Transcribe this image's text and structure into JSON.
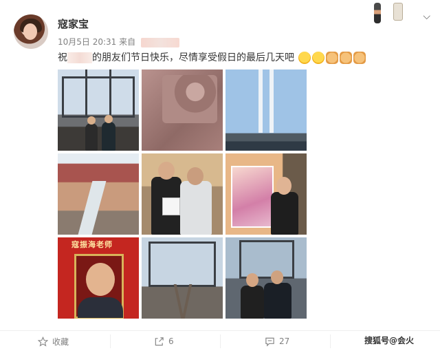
{
  "user": {
    "name": "寇家宝"
  },
  "meta": {
    "time": "10月5日 20:31",
    "source_prefix": "来自"
  },
  "post": {
    "text_before": "祝",
    "text_after": "的朋友们节日快乐，尽情享受假日的最后几天吧"
  },
  "photos": [
    {
      "icon": "bridge-photo"
    },
    {
      "icon": "relief-plaque-photo"
    },
    {
      "icon": "cable-bridge-photo"
    },
    {
      "icon": "red-beach-photo"
    },
    {
      "icon": "couple-photo"
    },
    {
      "icon": "poster-photo"
    },
    {
      "icon": "portrait-banner-photo",
      "banner_text": "寇振海老师"
    },
    {
      "icon": "railway-bridge-photo"
    },
    {
      "icon": "two-men-bridge-photo"
    }
  ],
  "actions": {
    "favorite_label": "收藏",
    "share_count": "6",
    "comment_count": "27"
  },
  "watermark": "搜狐号@会火",
  "colors": {
    "text_main": "#333333",
    "text_meta": "#808080",
    "banner_red": "#c42620"
  }
}
